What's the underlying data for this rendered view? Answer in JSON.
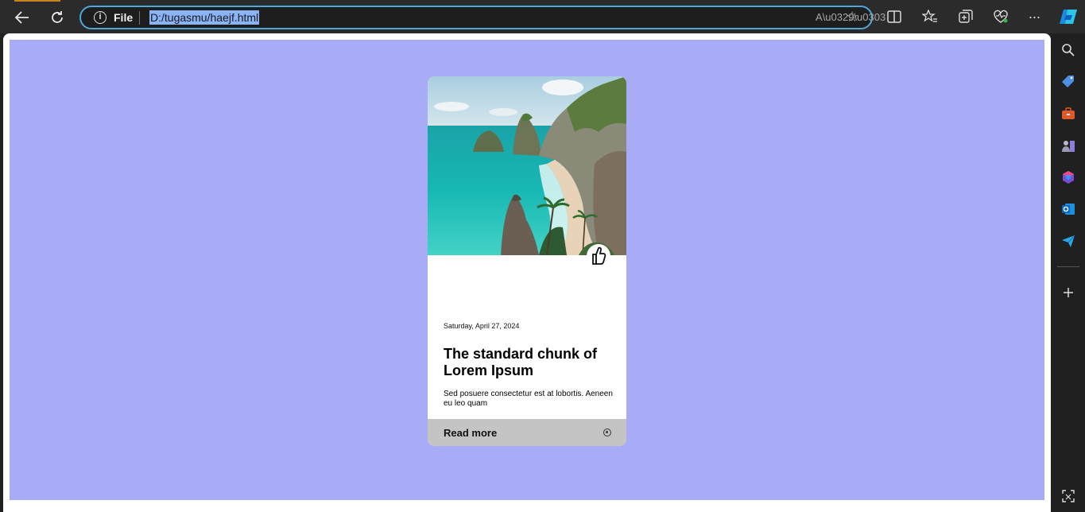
{
  "browser": {
    "address_bar": {
      "scheme_label": "File",
      "url": "D:/tugasmu/haejf.html",
      "read_aloud_label": "Ã̩"
    },
    "icons": [
      "back-icon",
      "refresh-icon",
      "info-icon",
      "read-aloud-icon",
      "favorite-star-icon",
      "split-screen-icon",
      "favorites-icon",
      "collections-icon",
      "health-icon",
      "more-icon",
      "copilot-icon"
    ],
    "sidebar_icons": [
      "search-icon",
      "shopping-tag-icon",
      "tools-icon",
      "games-icon",
      "office-icon",
      "outlook-icon",
      "send-icon",
      "add-icon",
      "screenshot-icon"
    ]
  },
  "page": {
    "background_color": "#a8acf6",
    "card": {
      "image_alt": "tropical beach with cliffs",
      "date": "Saturday, April 27, 2024",
      "title": "The standard chunk of Lorem Ipsum",
      "description": "Sed posuere consectetur est at lobortis. Aeneen eu leo quam",
      "read_more_label": "Read more",
      "footer_color": "#c4c4c4"
    }
  }
}
